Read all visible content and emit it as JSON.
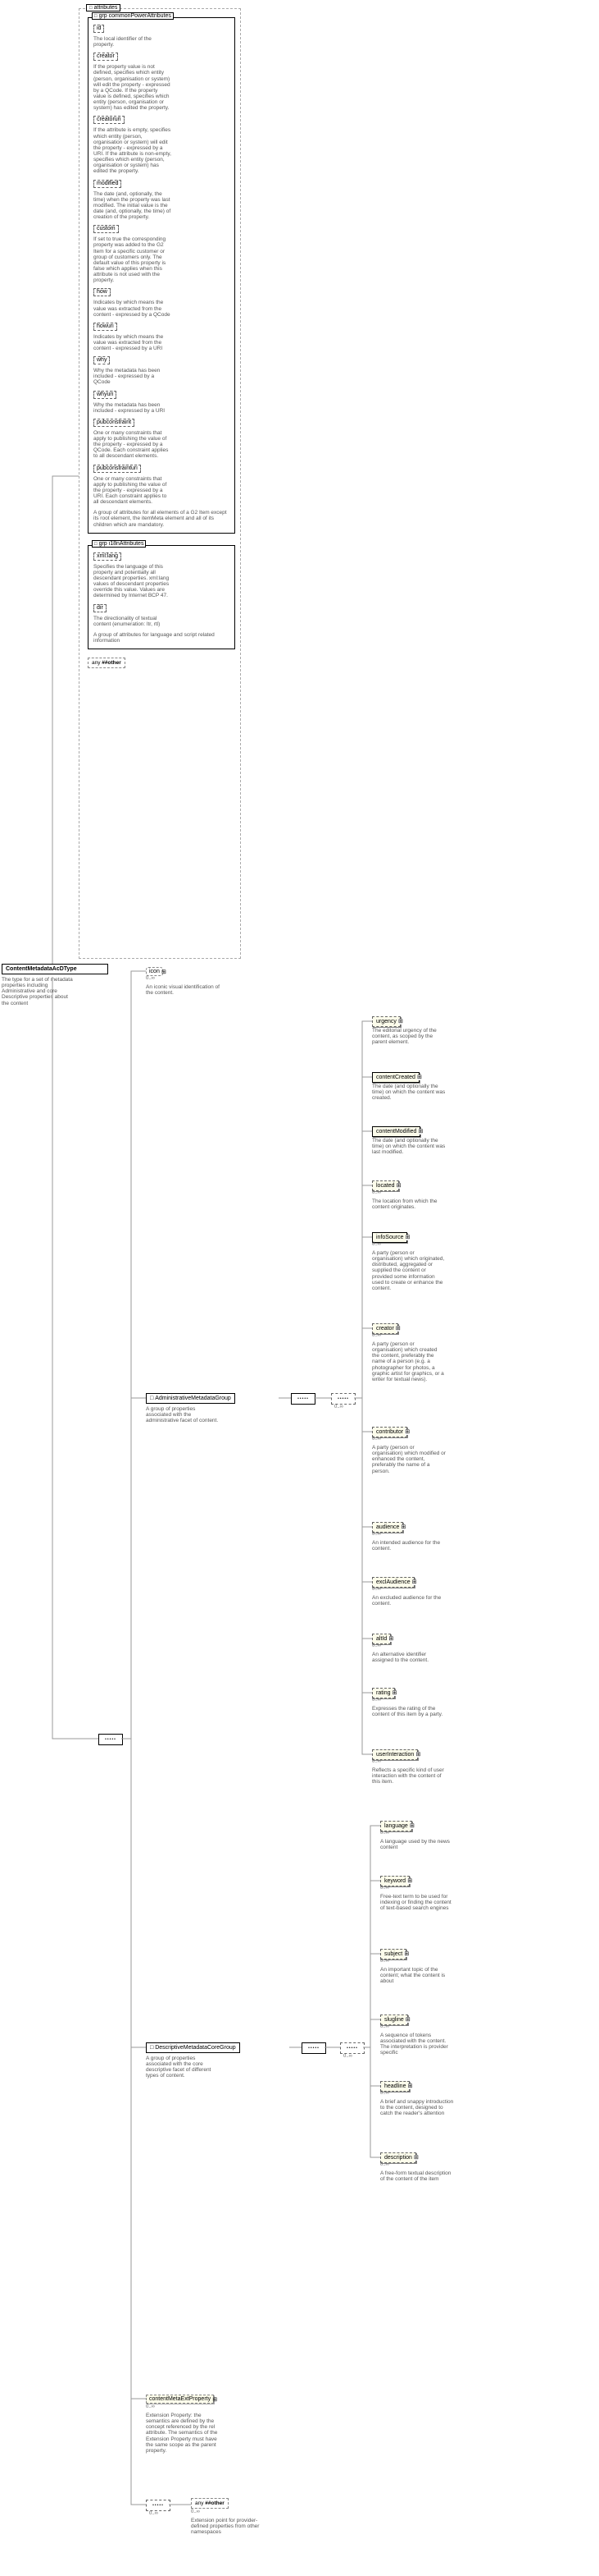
{
  "root": {
    "name": "ContentMetadataAcDType",
    "desc": "The type for a  set of metadata properties including Administrative and core Descriptive properties about the content"
  },
  "attributesHeader": "attributes",
  "commonPower": {
    "header": "commonPowerAttributes",
    "items": [
      {
        "name": "id",
        "desc": "The local identifier of the property."
      },
      {
        "name": "creator",
        "desc": "If the property value is not defined, specifies which entity (person, organisation or system) will edit the property - expressed by a QCode. If the property value is defined, specifies which entity (person, organisation or system) has edited the property."
      },
      {
        "name": "creatoruri",
        "desc": "If the attribute is empty, specifies which entity (person, organisation or system) will edit the property - expressed by a URI. If the attribute is non-empty, specifies which entity (person, organisation or system) has edited the property."
      },
      {
        "name": "modified",
        "desc": "The date (and, optionally, the time) when the property was last modified. The initial value is the date (and, optionally, the time) of creation of the property."
      },
      {
        "name": "custom",
        "desc": "If set to true the corresponding property was added to the G2 Item for a specific customer or group of customers only. The default value of this property is false which applies when this attribute is not used with the property."
      },
      {
        "name": "how",
        "desc": "Indicates by which means the value was extracted from the content - expressed by a QCode"
      },
      {
        "name": "howuri",
        "desc": "Indicates by which means the value was extracted from the content - expressed by a URI"
      },
      {
        "name": "why",
        "desc": "Why the metadata has been included - expressed by a QCode"
      },
      {
        "name": "whyuri",
        "desc": "Why the metadata has been included - expressed by a URI"
      },
      {
        "name": "pubconstraint",
        "desc": "One or many constraints that apply to publishing the value of the property - expressed by a QCode. Each constraint applies to all descendant elements."
      },
      {
        "name": "pubconstrainturi",
        "desc": "One or many constraints that apply to publishing the value of the property - expressed by a URI. Each constraint applies to all descendant elements."
      }
    ],
    "groupDesc": "A group of attributes for all elements of a G2 Item except its root element, the itemMeta element and all of its children which are mandatory."
  },
  "i18n": {
    "header": "i18nAttributes",
    "items": [
      {
        "name": "xml:lang",
        "desc": "Specifies the language of this property and potentially all descendant properties. xml:lang values of descendant properties override this value. Values are determined by Internet BCP 47."
      },
      {
        "name": "dir",
        "desc": "The directionality of textual content (enumeration: ltr, rtl)"
      }
    ],
    "groupDesc": "A group of attributes for language and script related information"
  },
  "anyOther": "##other",
  "icon": {
    "name": "icon",
    "desc": "An iconic visual identification of the content.",
    "card": "0..∞"
  },
  "adminGroup": {
    "name": "AdministrativeMetadataGroup",
    "desc": "A group of properties associated with the administrative facet of content.",
    "items": [
      {
        "name": "urgency",
        "desc": "The editorial urgency of the content, as scoped by the parent element.",
        "solid": false,
        "plus": true
      },
      {
        "name": "contentCreated",
        "desc": "The date (and optionally the time) on which the content was created.",
        "solid": true,
        "plus": true
      },
      {
        "name": "contentModified",
        "desc": "The date (and optionally the time) on which the content was last modified.",
        "solid": true,
        "plus": true
      },
      {
        "name": "located",
        "desc": "The location from which the content originates.",
        "solid": false,
        "plus": true,
        "card": "0..∞"
      },
      {
        "name": "infoSource",
        "desc": "A party (person or organisation) which originated, distributed, aggregated or supplied the content or provided some information used to create or enhance the content.",
        "solid": true,
        "plus": true,
        "card": "0..∞"
      },
      {
        "name": "creator",
        "desc": "A party (person or organisation) which created the content, preferably the name of a person (e.g. a photographer for photos, a graphic artist for graphics, or a writer for textual news).",
        "solid": false,
        "plus": true,
        "card": "0..∞"
      },
      {
        "name": "contributor",
        "desc": "A party (person or organisation) which modified or enhanced the content, preferably the name of a person.",
        "solid": false,
        "plus": true,
        "card": "0..∞"
      },
      {
        "name": "audience",
        "desc": "An intended audience for the content.",
        "solid": false,
        "plus": true,
        "card": "0..∞"
      },
      {
        "name": "exclAudience",
        "desc": "An excluded audience for the content.",
        "solid": false,
        "plus": true,
        "card": "0..∞"
      },
      {
        "name": "altId",
        "desc": "An alternative identifier assigned to the content.",
        "solid": false,
        "plus": true,
        "card": "0..∞"
      },
      {
        "name": "rating",
        "desc": "Expresses the rating of the content of this item by a party.",
        "solid": false,
        "plus": true,
        "card": "0..∞"
      },
      {
        "name": "userInteraction",
        "desc": "Reflects a specific kind of user interaction with the content of this item.",
        "solid": false,
        "plus": true,
        "card": "0..∞"
      }
    ]
  },
  "descGroup": {
    "name": "DescriptiveMetadataCoreGroup",
    "desc": "A group of properties associated with the core descriptive facet of different types of content.",
    "items": [
      {
        "name": "language",
        "desc": "A language used by the news content",
        "solid": false,
        "plus": true,
        "card": "0..∞"
      },
      {
        "name": "keyword",
        "desc": "Free-text term to be used for indexing or finding the content of text-based search engines",
        "solid": false,
        "plus": true,
        "card": "0..∞"
      },
      {
        "name": "subject",
        "desc": "An important topic of the content; what the content is about",
        "solid": false,
        "plus": true,
        "card": "0..∞"
      },
      {
        "name": "slugline",
        "desc": "A sequence of tokens associated with the content. The interpretation is provider specific",
        "solid": false,
        "plus": true,
        "card": "0..∞"
      },
      {
        "name": "headline",
        "desc": "A brief and snappy introduction to the content, designed to catch the reader's attention",
        "solid": false,
        "plus": true,
        "card": "0..∞"
      },
      {
        "name": "description",
        "desc": "A free-form textual description of the content of the item",
        "solid": false,
        "plus": true,
        "card": "0..∞"
      }
    ]
  },
  "extProp": {
    "name": "contentMetaExtProperty",
    "desc": "Extension Property: the semantics are defined by the concept referenced by the rel attribute. The semantics of the Extension Property must have the same scope as the parent property.",
    "card": "0..∞"
  },
  "extAny": {
    "label": "##other",
    "desc": "Extension point for provider-defined properties from other namespaces",
    "card": "0..∞"
  },
  "anyLabelPrefix": "any"
}
